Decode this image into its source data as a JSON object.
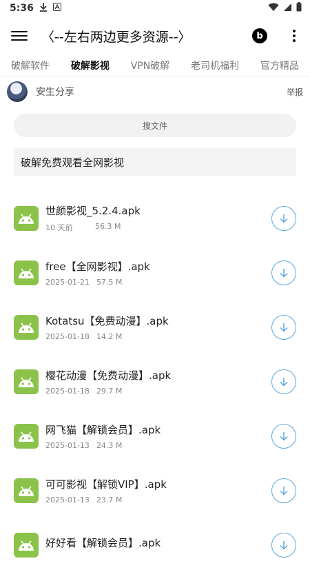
{
  "status_bar": {
    "time": "5:36"
  },
  "app_bar": {
    "title": "〈--左右两边更多资源--〉",
    "beats_letter": "b"
  },
  "tabs": [
    {
      "label": "破解软件",
      "active": false
    },
    {
      "label": "破解影视",
      "active": true
    },
    {
      "label": "VPN破解",
      "active": false
    },
    {
      "label": "老司机福利",
      "active": false
    },
    {
      "label": "官方精品",
      "active": false
    }
  ],
  "user": {
    "name": "安生分享",
    "report_label": "举报"
  },
  "search": {
    "label": "搜文件"
  },
  "description": "破解免费观看全网影视",
  "files": [
    {
      "name": "世颜影视_5.2.4.apk",
      "date": "10 天前",
      "size": "56.3 M"
    },
    {
      "name": "free【全网影视】.apk",
      "date": "2025-01-21",
      "size": "57.5 M"
    },
    {
      "name": "Kotatsu【免费动漫】.apk",
      "date": "2025-01-18",
      "size": "14.2 M"
    },
    {
      "name": "樱花动漫【免费动漫】.apk",
      "date": "2025-01-18",
      "size": "29.7 M"
    },
    {
      "name": "网飞猫【解锁会员】.apk",
      "date": "2025-01-13",
      "size": "24.3 M"
    },
    {
      "name": "可可影视【解锁VIP】.apk",
      "date": "2025-01-13",
      "size": "23.7 M"
    },
    {
      "name": "好好看【解锁会员】.apk",
      "date": "",
      "size": ""
    }
  ],
  "colors": {
    "accent": "#5aa8e0",
    "apk_green": "#8bc34a"
  }
}
